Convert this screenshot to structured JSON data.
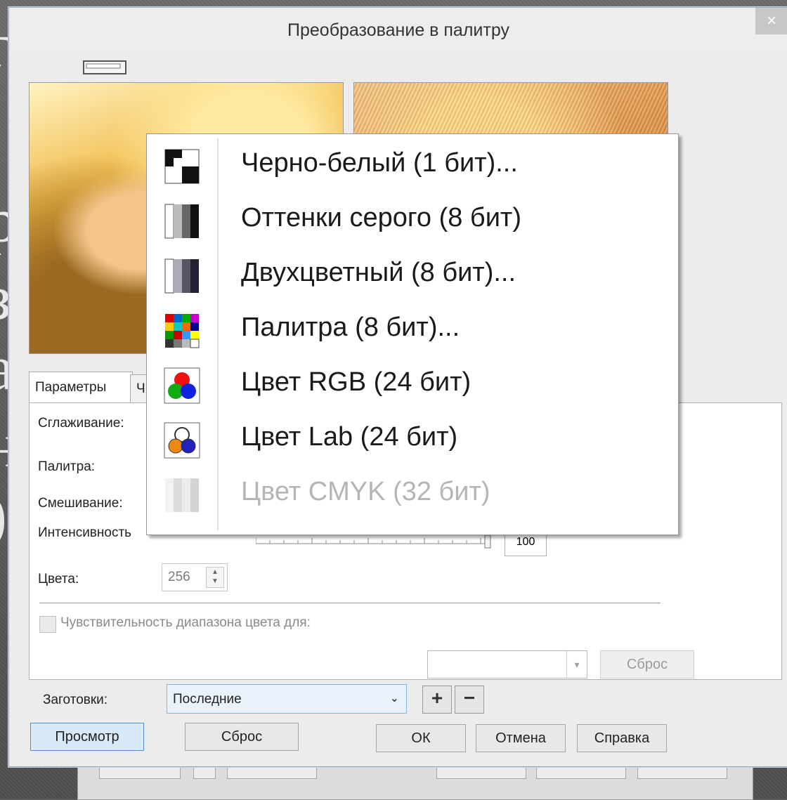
{
  "background": {
    "letters": [
      "г",
      "р",
      "з",
      "а",
      "н",
      ")"
    ]
  },
  "dialog": {
    "title": "Преобразование в палитру",
    "close_label": "×",
    "tabs": [
      {
        "label": "Параметры",
        "active": true
      },
      {
        "label": "Ч",
        "active": false
      }
    ],
    "labels": {
      "smoothing": "Сглаживание:",
      "palette": "Палитра:",
      "dithering": "Смешивание:",
      "intensity": "Интенсивность",
      "colors": "Цвета:",
      "sensitivity": "Чувствительность диапазона цвета для:",
      "presets": "Заготовки:"
    },
    "colors_value": "256",
    "intensity_value": "100",
    "presets_value": "Последние",
    "buttons": {
      "reset_inner": "Сброс",
      "preview": "Просмотр",
      "reset": "Сброс",
      "ok": "ОК",
      "cancel": "Отмена",
      "help": "Справка",
      "add": "+",
      "remove": "−"
    }
  },
  "menu": {
    "items": [
      {
        "label": "Черно-белый (1 бит)...",
        "icon": "black-white-icon",
        "enabled": true
      },
      {
        "label": "Оттенки серого (8 бит)",
        "icon": "grayscale-icon",
        "enabled": true
      },
      {
        "label": "Двухцветный (8 бит)...",
        "icon": "duotone-icon",
        "enabled": true
      },
      {
        "label": "Палитра (8 бит)...",
        "icon": "palette-icon",
        "enabled": true
      },
      {
        "label": "Цвет RGB (24 бит)",
        "icon": "rgb-icon",
        "enabled": true
      },
      {
        "label": "Цвет Lab (24 бит)",
        "icon": "lab-icon",
        "enabled": true
      },
      {
        "label": "Цвет CMYK (32 бит)",
        "icon": "cmyk-icon",
        "enabled": false
      }
    ]
  }
}
